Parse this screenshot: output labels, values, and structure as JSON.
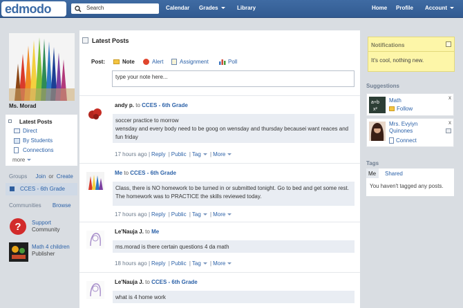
{
  "brand": {
    "logo": "edmodo"
  },
  "search": {
    "placeholder": "Search"
  },
  "topnav": {
    "calendar": "Calendar",
    "grades": "Grades",
    "library": "Library",
    "home": "Home",
    "profile": "Profile",
    "account": "Account"
  },
  "profile": {
    "name": "Ms. Morad"
  },
  "leftnav": {
    "latest": "Latest Posts",
    "direct": "Direct",
    "by_students": "By Students",
    "connections": "Connections",
    "more": "more"
  },
  "groups": {
    "label": "Groups",
    "join": "Join",
    "or": "or",
    "create": "Create",
    "items": [
      "CCES - 6th Grade"
    ]
  },
  "communities": {
    "label": "Communities",
    "browse": "Browse",
    "items": [
      {
        "name": "Support",
        "sub": "Community"
      },
      {
        "name": "Math 4 children",
        "sub": "Publisher"
      }
    ]
  },
  "main": {
    "title": "Latest Posts"
  },
  "composer": {
    "label": "Post:",
    "tabs": [
      "Note",
      "Alert",
      "Assignment",
      "Poll"
    ],
    "placeholder": "type your note here..."
  },
  "posts": [
    {
      "author": "andy p.",
      "to": "to",
      "group": "CCES - 6th Grade",
      "body": "soccer practice to morrow\nwensday and every body need to be goog on wensday and thursday becausei want reaces and fun friday",
      "time": "17 hours ago"
    },
    {
      "author": "Me",
      "to": "to",
      "group": "CCES - 6th Grade",
      "body": "Class, there is NO homework to be turned in or submitted tonight. Go to bed and get some rest. The homework was to PRACTICE the skills reviewed today.",
      "time": "17 hours ago"
    },
    {
      "author": "Le'Nauja J.",
      "to": "to",
      "group": "Me",
      "body": "ms.morad is there certain questions 4 da math",
      "time": "18 hours ago"
    },
    {
      "author": "Le'Nauja J.",
      "to": "to",
      "group": "CCES - 6th Grade",
      "body": "what is 4 home work",
      "time": ""
    }
  ],
  "post_actions": {
    "reply": "Reply",
    "public": "Public",
    "tag": "Tag",
    "more": "More",
    "sep": "|"
  },
  "notifications": {
    "title": "Notifications",
    "text": "It's cool, nothing new."
  },
  "suggestions": {
    "title": "Suggestions",
    "close": "x",
    "items": [
      {
        "name": "Math",
        "action": "Follow"
      },
      {
        "name": "Mrs. Evyiyn Quinones",
        "action": "Connect"
      }
    ]
  },
  "tags": {
    "title": "Tags",
    "tabs": [
      "Me",
      "Shared"
    ],
    "empty": "You haven't tagged any posts."
  }
}
